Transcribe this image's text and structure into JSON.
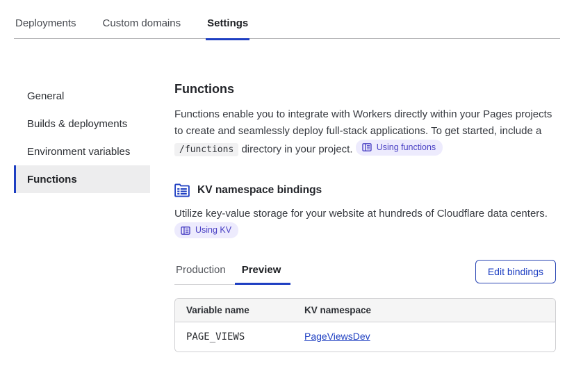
{
  "header": {
    "tabs": [
      {
        "label": "Deployments",
        "active": false
      },
      {
        "label": "Custom domains",
        "active": false
      },
      {
        "label": "Settings",
        "active": true
      }
    ]
  },
  "sidebar": {
    "items": [
      {
        "label": "General",
        "active": false
      },
      {
        "label": "Builds & deployments",
        "active": false
      },
      {
        "label": "Environment variables",
        "active": false
      },
      {
        "label": "Functions",
        "active": true
      }
    ]
  },
  "functions_section": {
    "title": "Functions",
    "description_before_code": "Functions enable you to integrate with Workers directly within your Pages projects to create and seamlessly deploy full-stack applications. To get started, include a ",
    "code": "/functions",
    "description_after_code": " directory in your project.",
    "doc_badge_label": "Using functions"
  },
  "kv_section": {
    "title": "KV namespace bindings",
    "icon": "kv-bindings-icon",
    "description": "Utilize key-value storage for your website at hundreds of Cloudflare data centers.",
    "doc_badge_label": "Using KV"
  },
  "environment_tabs": [
    {
      "label": "Production",
      "active": false
    },
    {
      "label": "Preview",
      "active": true
    }
  ],
  "edit_button": {
    "label": "Edit bindings"
  },
  "bindings_table": {
    "columns": [
      "Variable name",
      "KV namespace"
    ],
    "rows": [
      {
        "variable_name": "PAGE_VIEWS",
        "kv_namespace": "PageViewsDev"
      }
    ]
  },
  "colors": {
    "accent_blue": "#1e3fc2",
    "link_blue": "#1e3fc2",
    "badge_bg": "#edebfd",
    "badge_text": "#4a41c4",
    "active_sidebar_bg": "#ededee",
    "table_header_bg": "#f5f5f5",
    "border_gray": "#cfcfd2",
    "code_chip_bg": "#f1f1f2"
  }
}
